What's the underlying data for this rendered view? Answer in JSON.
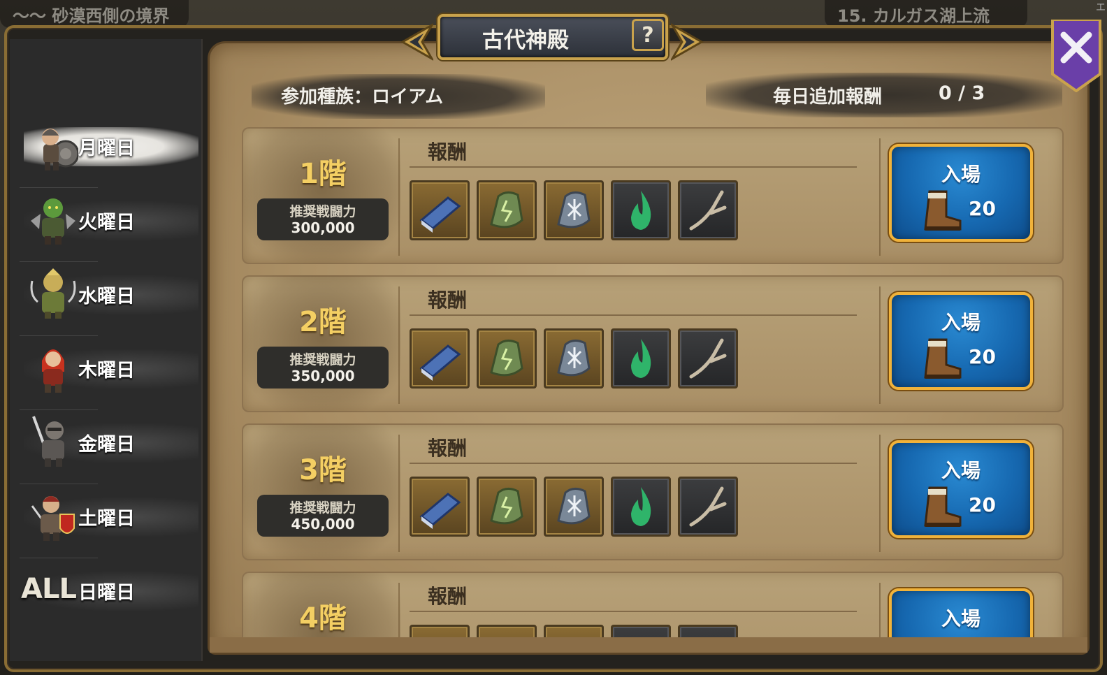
{
  "background": {
    "left_location": "〜〜 砂漠西側の境界",
    "right_location": "15. カルガス湖上流",
    "edge_glyph": "エ"
  },
  "title": {
    "text": "古代神殿",
    "help_label": "?"
  },
  "header": {
    "tribe": "参加種族：ロイアム",
    "daily_reward_label": "毎日追加報酬",
    "daily_reward_value": "0 / 3"
  },
  "sidebar": {
    "days": [
      {
        "label": "月曜日",
        "hero": "warrior-with-shield",
        "active": true
      },
      {
        "label": "火曜日",
        "hero": "green-orc"
      },
      {
        "label": "水曜日",
        "hero": "gold-armored-knight"
      },
      {
        "label": "木曜日",
        "hero": "red-haired-fighter"
      },
      {
        "label": "金曜日",
        "hero": "gray-armored-swordsman"
      },
      {
        "label": "土曜日",
        "hero": "red-shield-soldier"
      },
      {
        "label": "日曜日",
        "prefix": "ALL"
      }
    ]
  },
  "floors": [
    {
      "floor": "1階",
      "power_label": "推奨戦闘力",
      "power": "300,000",
      "reward_label": "報酬",
      "enter_label": "入場",
      "cost": "20",
      "items": [
        "blue-book-icon",
        "green-rune-stone-icon",
        "gray-rune-stone-icon",
        "green-flame-icon",
        "bone-branch-icon"
      ]
    },
    {
      "floor": "2階",
      "power_label": "推奨戦闘力",
      "power": "350,000",
      "reward_label": "報酬",
      "enter_label": "入場",
      "cost": "20",
      "items": [
        "blue-book-icon",
        "green-rune-stone-icon",
        "gray-rune-stone-icon",
        "green-flame-icon",
        "bone-branch-icon"
      ]
    },
    {
      "floor": "3階",
      "power_label": "推奨戦闘力",
      "power": "450,000",
      "reward_label": "報酬",
      "enter_label": "入場",
      "cost": "20",
      "items": [
        "blue-book-icon",
        "green-rune-stone-icon",
        "gray-rune-stone-icon",
        "green-flame-icon",
        "bone-branch-icon"
      ]
    },
    {
      "floor": "4階",
      "reward_label": "報酬",
      "enter_label": "入場"
    }
  ],
  "colors": {
    "floor_number": "#f4cf63",
    "enter_button": "#1668b0",
    "enter_border": "#f0b23a",
    "parchment": "#ab9066",
    "close_button": "#6a3fa8"
  }
}
